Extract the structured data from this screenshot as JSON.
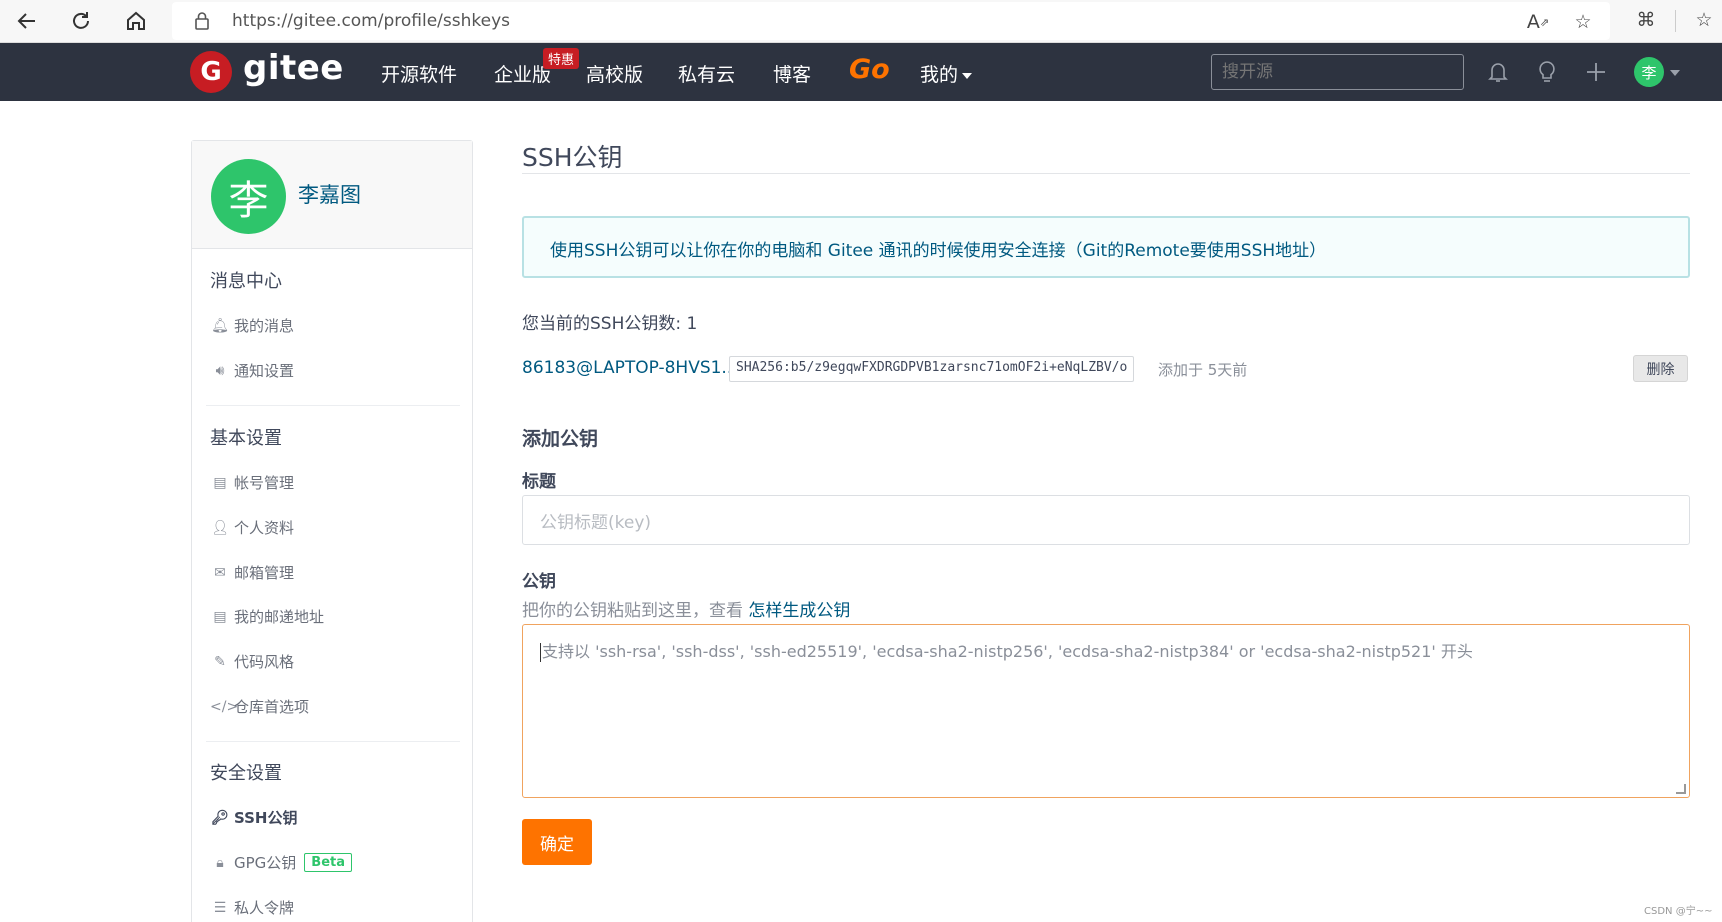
{
  "browser": {
    "url": "https://gitee.com/profile/sshkeys"
  },
  "header": {
    "logo_text": "gitee",
    "nav": [
      "开源软件",
      "企业版",
      "高校版",
      "私有云",
      "博客"
    ],
    "go_label": "Go",
    "mine_label": "我的",
    "special_badge": "特惠",
    "search_placeholder": "搜开源",
    "avatar_char": "李"
  },
  "sidebar": {
    "avatar_char": "李",
    "user_name": "李嘉图",
    "sections": [
      {
        "title": "消息中心",
        "items": [
          "我的消息",
          "通知设置"
        ]
      },
      {
        "title": "基本设置",
        "items": [
          "帐号管理",
          "个人资料",
          "邮箱管理",
          "我的邮递地址",
          "代码风格",
          "仓库首选项"
        ]
      },
      {
        "title": "安全设置",
        "items": [
          "SSH公钥",
          "GPG公钥",
          "私人令牌"
        ]
      }
    ],
    "beta_badge": "Beta"
  },
  "main": {
    "title": "SSH公钥",
    "info": "使用SSH公钥可以让你在你的电脑和 Gitee 通讯的时候使用安全连接（Git的Remote要使用SSH地址）",
    "key_count_label": "您当前的SSH公钥数: 1",
    "key": {
      "title": "86183@LAPTOP-8HVS1...",
      "fingerprint": "SHA256:b5/z9egqwFXDRGDPVB1zarsnc71omOF2i+eNqLZBV/o",
      "added": "添加于 5天前",
      "delete_label": "删除"
    },
    "add_title": "添加公钥",
    "label_title": "标题",
    "title_placeholder": "公钥标题(key)",
    "label_key": "公钥",
    "hint_text": "把你的公钥粘贴到这里，查看 ",
    "hint_link": "怎样生成公钥",
    "key_placeholder": "支持以 'ssh-rsa', 'ssh-dss', 'ssh-ed25519', 'ecdsa-sha2-nistp256', 'ecdsa-sha2-nistp384' or 'ecdsa-sha2-nistp521' 开头",
    "submit_label": "确定"
  },
  "watermark": "CSDN @宁~~"
}
